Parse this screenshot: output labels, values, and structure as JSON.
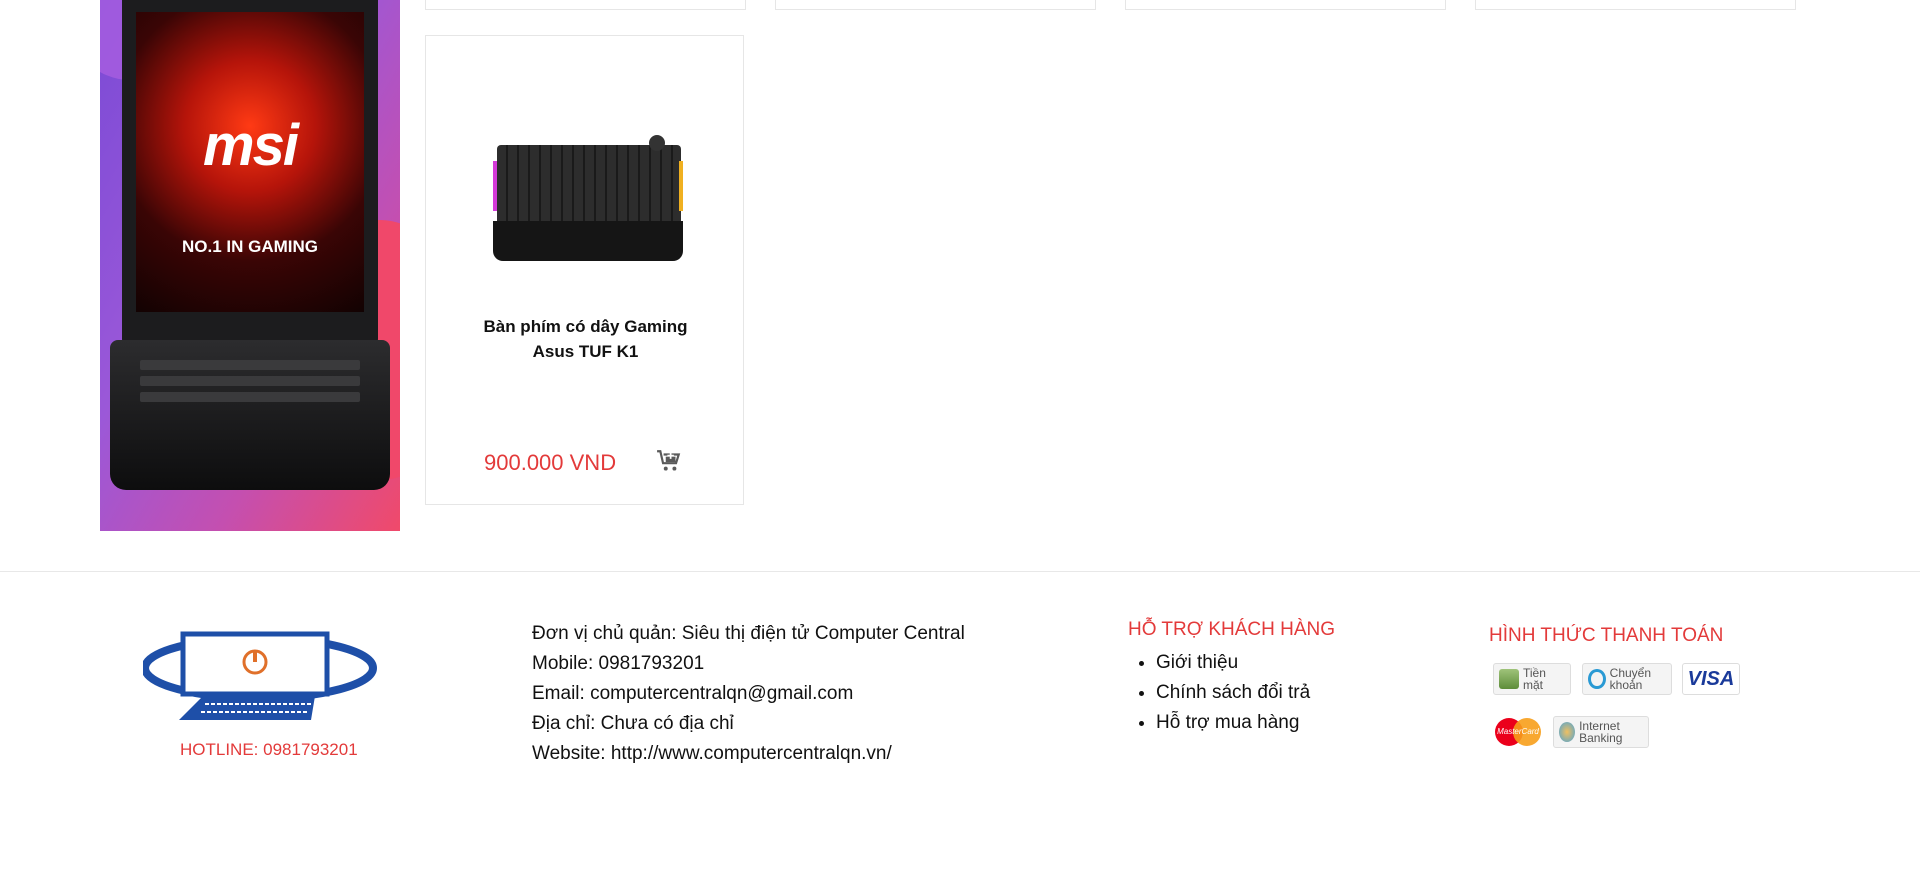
{
  "banner": {
    "brand": "msi",
    "tagline": "NO.1 IN GAMING"
  },
  "product": {
    "name": "Bàn phím có dây Gaming Asus TUF K1",
    "price": "900.000 VND"
  },
  "footer": {
    "hotline": "HOTLINE: 0981793201",
    "info": {
      "owner": "Đơn vị chủ quản: Siêu thị điện tử Computer Central",
      "mobile": "Mobile: 0981793201",
      "email": "Email: computercentralqn@gmail.com",
      "address": "Địa chỉ: Chưa có địa chỉ",
      "website": "Website: http://www.computercentralqn.vn/"
    },
    "support": {
      "title": "HỖ TRỢ KHÁCH HÀNG",
      "items": [
        "Giới thiệu",
        "Chính sách đổi trả",
        "Hỗ trợ mua hàng"
      ]
    },
    "payment": {
      "title": "HÌNH THỨC THANH TOÁN",
      "cash": "Tiền mặt",
      "transfer": "Chuyển khoản",
      "visa": "VISA",
      "mastercard": "MasterCard",
      "internet_banking": "Internet Banking"
    }
  }
}
